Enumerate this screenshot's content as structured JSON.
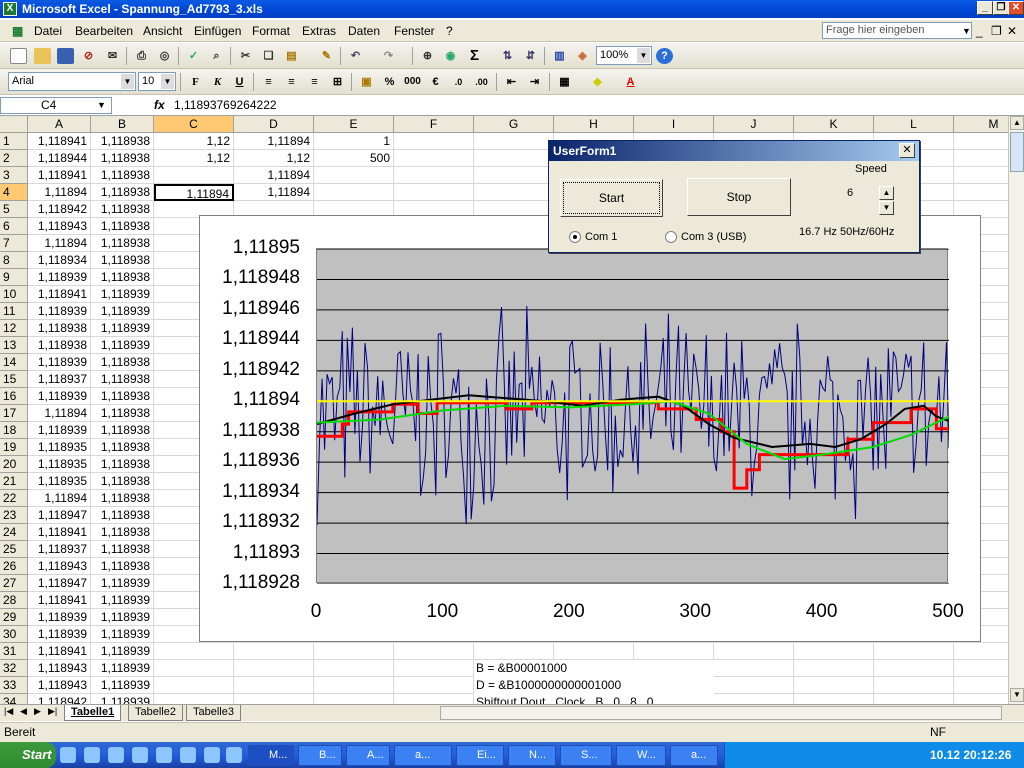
{
  "window": {
    "title": "Microsoft Excel - Spannung_Ad7793_3.xls",
    "app_icon": "excel-icon"
  },
  "menu": {
    "items": [
      "Datei",
      "Bearbeiten",
      "Ansicht",
      "Einfügen",
      "Format",
      "Extras",
      "Daten",
      "Fenster",
      "?"
    ],
    "help_placeholder": "Frage hier eingeben"
  },
  "toolbar": {
    "zoom": "100%"
  },
  "format_toolbar": {
    "font": "Arial",
    "size": "10"
  },
  "formula_bar": {
    "cell_ref": "C4",
    "fx": "fx",
    "value": "1,11893769264222"
  },
  "columns": [
    "A",
    "B",
    "C",
    "D",
    "E",
    "F",
    "G",
    "H",
    "I",
    "J",
    "K",
    "L",
    "M"
  ],
  "rows": [
    "1",
    "2",
    "3",
    "4",
    "5",
    "6",
    "7",
    "8",
    "9",
    "10",
    "11",
    "12",
    "13",
    "14",
    "15",
    "16",
    "17",
    "18",
    "19",
    "20",
    "21",
    "22",
    "23",
    "24",
    "25",
    "26",
    "27",
    "28",
    "29",
    "30",
    "31",
    "32",
    "33",
    "34"
  ],
  "col_a": [
    "1,118941",
    "1,118944",
    "1,118941",
    "1,11894",
    "1,118942",
    "1,118943",
    "1,11894",
    "1,118934",
    "1,118939",
    "1,118941",
    "1,118939",
    "1,118938",
    "1,118938",
    "1,118939",
    "1,118937",
    "1,118939",
    "1,11894",
    "1,118939",
    "1,118935",
    "1,118935",
    "1,118935",
    "1,11894",
    "1,118947",
    "1,118941",
    "1,118937",
    "1,118943",
    "1,118947",
    "1,118941",
    "1,118939",
    "1,118939",
    "1,118941",
    "1,118943",
    "1,118943",
    "1,118942"
  ],
  "col_b": [
    "1,118938",
    "1,118938",
    "1,118938",
    "1,118938",
    "1,118938",
    "1,118938",
    "1,118938",
    "1,118938",
    "1,118938",
    "1,118939",
    "1,118939",
    "1,118939",
    "1,118939",
    "1,118938",
    "1,118938",
    "1,118938",
    "1,118938",
    "1,118938",
    "1,118938",
    "1,118938",
    "1,118938",
    "1,118938",
    "1,118938",
    "1,118938",
    "1,118938",
    "1,118938",
    "1,118939",
    "1,118939",
    "1,118939",
    "1,118939",
    "1,118939",
    "1,118939",
    "1,118939",
    "1,118939"
  ],
  "extra_cells": {
    "c1": "1,12",
    "d1": "1,11894",
    "e1": "1",
    "c2": "1,12",
    "d2": "1,12",
    "e2": "500",
    "d3": "1,11894",
    "c4": "1,11894",
    "d4": "1,11894",
    "g32": "B = &B00001000",
    "g33": "D = &B1000000000001000",
    "g34": "Shiftout Dout , Clock , B , 0 , 8 , 0"
  },
  "sheet_tabs": [
    "Tabelle1",
    "Tabelle2",
    "Tabelle3"
  ],
  "status": {
    "left": "Bereit",
    "right": "NF"
  },
  "taskbar": {
    "start": "Start",
    "items": [
      "M...",
      "B...",
      "A...",
      "a...",
      "Ei...",
      "N...",
      "S...",
      "W...",
      "a..."
    ],
    "clock": "10.12  20:12:26"
  },
  "userform": {
    "title": "UserForm1",
    "start_label": "Start",
    "stop_label": "Stop",
    "speed_label": "Speed",
    "speed_value": "6",
    "radio_com1": "Com 1",
    "radio_com3": "Com 3 (USB)",
    "freq_label": "16.7 Hz 50Hz/60Hz"
  },
  "colors": {
    "blue": "#000080",
    "black": "#000000",
    "red": "#ff0000",
    "green": "#00dd00",
    "yellow": "#ffff00",
    "plot_bg": "#c0c0c0"
  },
  "chart_data": {
    "type": "line",
    "x_range": [
      0,
      500
    ],
    "y_range": [
      1.118928,
      1.11895
    ],
    "x_ticks": [
      "0",
      "100",
      "200",
      "300",
      "400",
      "500"
    ],
    "y_ticks": [
      "1,11895",
      "1,118948",
      "1,118946",
      "1,118944",
      "1,118942",
      "1,11894",
      "1,118938",
      "1,118936",
      "1,118934",
      "1,118932",
      "1,11893",
      "1,118928"
    ],
    "grid": true,
    "legend": "none",
    "series": [
      {
        "color": "#000080",
        "style": "noisy",
        "center": 1.118939,
        "amplitude": 7.5e-06
      },
      {
        "color": "#ff0000",
        "style": "step",
        "points": [
          [
            0,
            1.1189377
          ],
          [
            20,
            1.1189377
          ],
          [
            20,
            1.1189385
          ],
          [
            25,
            1.1189385
          ],
          [
            25,
            1.1189393
          ],
          [
            60,
            1.1189393
          ],
          [
            60,
            1.1189398
          ],
          [
            80,
            1.1189398
          ],
          [
            80,
            1.1189392
          ],
          [
            95,
            1.1189392
          ],
          [
            95,
            1.1189399
          ],
          [
            150,
            1.1189399
          ],
          [
            150,
            1.1189395
          ],
          [
            170,
            1.1189395
          ],
          [
            170,
            1.1189399
          ],
          [
            270,
            1.1189399
          ],
          [
            270,
            1.1189395
          ],
          [
            300,
            1.1189395
          ],
          [
            300,
            1.1189388
          ],
          [
            320,
            1.1189388
          ],
          [
            320,
            1.118938
          ],
          [
            330,
            1.118938
          ],
          [
            330,
            1.1189343
          ],
          [
            340,
            1.1189343
          ],
          [
            340,
            1.1189355
          ],
          [
            350,
            1.1189355
          ],
          [
            350,
            1.1189365
          ],
          [
            420,
            1.1189365
          ],
          [
            420,
            1.1189375
          ],
          [
            440,
            1.1189375
          ],
          [
            440,
            1.1189386
          ],
          [
            470,
            1.1189386
          ],
          [
            470,
            1.1189395
          ],
          [
            490,
            1.1189395
          ],
          [
            490,
            1.1189382
          ],
          [
            500,
            1.1189382
          ]
        ]
      },
      {
        "color": "#000000",
        "style": "smooth",
        "points": [
          [
            0,
            1.1189385
          ],
          [
            30,
            1.1189392
          ],
          [
            60,
            1.1189398
          ],
          [
            90,
            1.1189401
          ],
          [
            120,
            1.1189404
          ],
          [
            150,
            1.1189402
          ],
          [
            180,
            1.11894
          ],
          [
            210,
            1.1189397
          ],
          [
            240,
            1.1189401
          ],
          [
            270,
            1.1189403
          ],
          [
            290,
            1.1189397
          ],
          [
            310,
            1.1189385
          ],
          [
            330,
            1.1189376
          ],
          [
            360,
            1.118937
          ],
          [
            390,
            1.1189372
          ],
          [
            410,
            1.118937
          ],
          [
            430,
            1.1189375
          ],
          [
            450,
            1.1189385
          ],
          [
            465,
            1.1189395
          ],
          [
            480,
            1.1189397
          ],
          [
            490,
            1.118939
          ],
          [
            500,
            1.1189387
          ]
        ]
      },
      {
        "color": "#00dd00",
        "style": "smooth",
        "points": [
          [
            0,
            1.1189386
          ],
          [
            50,
            1.1189388
          ],
          [
            100,
            1.1189394
          ],
          [
            150,
            1.1189397
          ],
          [
            200,
            1.1189396
          ],
          [
            250,
            1.1189398
          ],
          [
            280,
            1.11894
          ],
          [
            310,
            1.1189392
          ],
          [
            340,
            1.1189372
          ],
          [
            370,
            1.1189362
          ],
          [
            400,
            1.1189365
          ],
          [
            440,
            1.118937
          ],
          [
            470,
            1.1189378
          ],
          [
            500,
            1.118939
          ]
        ]
      },
      {
        "color": "#ffff00",
        "style": "flat",
        "points": [
          [
            0,
            1.11894
          ],
          [
            500,
            1.11894
          ]
        ]
      }
    ]
  }
}
